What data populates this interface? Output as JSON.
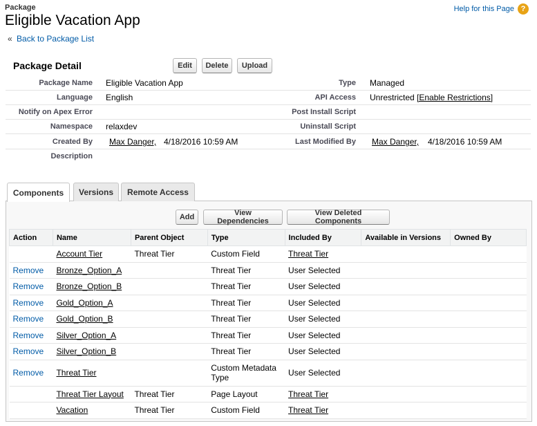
{
  "header": {
    "object_label": "Package",
    "title": "Eligible Vacation App",
    "help_link": "Help for this Page",
    "help_icon": "question-circle-icon",
    "back_link": "Back to Package List",
    "back_prefix": "«"
  },
  "detail": {
    "section_title": "Package Detail",
    "buttons": {
      "edit": "Edit",
      "delete": "Delete",
      "upload": "Upload"
    },
    "fields": {
      "package_name_label": "Package Name",
      "package_name": "Eligible Vacation App",
      "type_label": "Type",
      "type": "Managed",
      "language_label": "Language",
      "language": "English",
      "api_access_label": "API Access",
      "api_access": "Unrestricted",
      "enable_restrictions": "[Enable Restrictions]",
      "notify_label": "Notify on Apex Error",
      "post_install_label": "Post Install Script",
      "namespace_label": "Namespace",
      "namespace": "relaxdev",
      "uninstall_label": "Uninstall Script",
      "created_by_label": "Created By",
      "created_by": "Max Danger,",
      "created_date": "4/18/2016 10:59 AM",
      "modified_by_label": "Last Modified By",
      "modified_by": "Max Danger,",
      "modified_date": "4/18/2016 10:59 AM",
      "description_label": "Description"
    }
  },
  "tabs": [
    "Components",
    "Versions",
    "Remote Access"
  ],
  "components": {
    "buttons": {
      "add": "Add",
      "view_dependencies": "View Dependencies",
      "view_deleted": "View Deleted Components"
    },
    "columns": [
      "Action",
      "Name",
      "Parent Object",
      "Type",
      "Included By",
      "Available in Versions",
      "Owned By"
    ],
    "rows": [
      {
        "action": "",
        "name": "Account Tier",
        "parent": "Threat Tier",
        "type": "Custom Field",
        "included_by": "Threat Tier",
        "included_link": true
      },
      {
        "action": "Remove",
        "name": "Bronze_Option_A",
        "parent": "",
        "type": "Threat Tier",
        "included_by": "User Selected",
        "included_link": false
      },
      {
        "action": "Remove",
        "name": "Bronze_Option_B",
        "parent": "",
        "type": "Threat Tier",
        "included_by": "User Selected",
        "included_link": false
      },
      {
        "action": "Remove",
        "name": "Gold_Option_A",
        "parent": "",
        "type": "Threat Tier",
        "included_by": "User Selected",
        "included_link": false
      },
      {
        "action": "Remove",
        "name": "Gold_Option_B",
        "parent": "",
        "type": "Threat Tier",
        "included_by": "User Selected",
        "included_link": false
      },
      {
        "action": "Remove",
        "name": "Silver_Option_A",
        "parent": "",
        "type": "Threat Tier",
        "included_by": "User Selected",
        "included_link": false
      },
      {
        "action": "Remove",
        "name": "Silver_Option_B",
        "parent": "",
        "type": "Threat Tier",
        "included_by": "User Selected",
        "included_link": false
      },
      {
        "action": "Remove",
        "name": "Threat Tier",
        "parent": "",
        "type": "Custom Metadata Type",
        "included_by": "User Selected",
        "included_link": false
      },
      {
        "action": "",
        "name": "Threat Tier Layout",
        "parent": "Threat Tier",
        "type": "Page Layout",
        "included_by": "Threat Tier",
        "included_link": true
      },
      {
        "action": "",
        "name": "Vacation",
        "parent": "Threat Tier",
        "type": "Custom Field",
        "included_by": "Threat Tier",
        "included_link": true
      }
    ]
  }
}
